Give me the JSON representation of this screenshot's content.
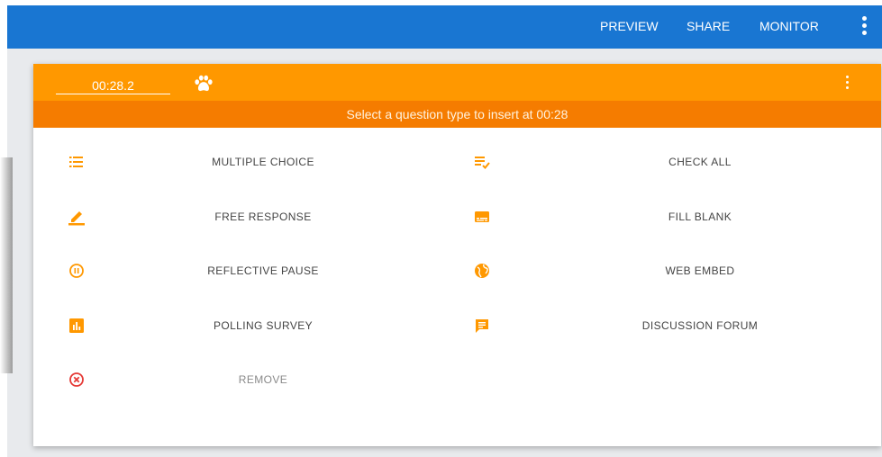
{
  "toolbar": {
    "preview_label": "PREVIEW",
    "share_label": "SHARE",
    "monitor_label": "MONITOR",
    "more_icon": "more-vert-icon"
  },
  "dialog": {
    "time_value": "00:28.2",
    "logo_icon": "paw-icon",
    "more_icon": "more-vert-icon",
    "instruction": "Select a question type to insert at 00:28",
    "options": {
      "multiple_choice": {
        "label": "MULTIPLE CHOICE",
        "icon": "list-icon"
      },
      "check_all": {
        "label": "CHECK ALL",
        "icon": "playlist-check-icon"
      },
      "free_response": {
        "label": "FREE RESPONSE",
        "icon": "pencil-icon"
      },
      "fill_blank": {
        "label": "FILL BLANK",
        "icon": "subtitles-icon"
      },
      "reflective_pause": {
        "label": "REFLECTIVE PAUSE",
        "icon": "pause-circle-icon"
      },
      "web_embed": {
        "label": "WEB EMBED",
        "icon": "globe-icon"
      },
      "polling_survey": {
        "label": "POLLING SURVEY",
        "icon": "poll-icon"
      },
      "discussion_forum": {
        "label": "DISCUSSION FORUM",
        "icon": "chat-icon"
      },
      "remove": {
        "label": "REMOVE",
        "icon": "cancel-circle-icon"
      }
    }
  },
  "colors": {
    "toolbar_blue": "#1976d2",
    "header_orange": "#ff9800",
    "instruction_orange": "#f57c00",
    "icon_orange": "#ff9800",
    "remove_red": "#e53935"
  }
}
